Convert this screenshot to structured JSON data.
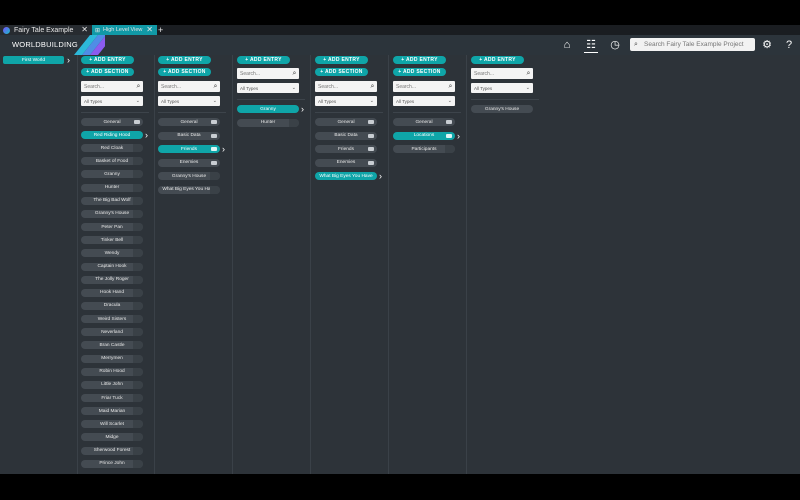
{
  "tabs": [
    {
      "label": "Fairy Tale Example",
      "close": "✕"
    },
    {
      "label": "High Level View",
      "close": "✕"
    }
  ],
  "tab_add": "+",
  "header": {
    "brand": "WORLDBUILDING",
    "search_placeholder": "Search Fairy Tale Example Project"
  },
  "col0": {
    "world": "First World"
  },
  "buttons": {
    "add_entry": "+ ADD ENTRY",
    "add_section": "+ ADD SECTION"
  },
  "search": {
    "placeholder": "Search...",
    "types": "All Types"
  },
  "col1": {
    "sections": [
      "General"
    ],
    "items": [
      "Red Riding Hood",
      "Red Cloak",
      "Basket of Food",
      "Granny",
      "Hunter",
      "The Big Bad Wolf",
      "Granny's House",
      "Peter Pan",
      "Tinker Bell",
      "Wendy",
      "Captain Hook",
      "The Jolly Roger",
      "Hook Hand",
      "Dracula",
      "Weird Sisters",
      "Neverland",
      "Bran Castle",
      "Merrymen",
      "Robin Hood",
      "Little John",
      "Friar Tuck",
      "Maid Marian",
      "Will Scarlet",
      "Midge",
      "Sherwood Forest",
      "Prince John"
    ]
  },
  "col2": {
    "items": [
      "General",
      "Basic Data",
      "Friends",
      "Enemies",
      "Granny's House",
      "What Big Eyes You Have"
    ]
  },
  "col3": {
    "items": [
      "Granny",
      "Hunter"
    ]
  },
  "col4": {
    "items": [
      "General",
      "Basic Data",
      "Friends",
      "Enemies",
      "What Big Eyes You Have"
    ]
  },
  "col5": {
    "items": [
      "General",
      "Locations",
      "Participants"
    ]
  },
  "col6": {
    "items": [
      "Granny's House"
    ]
  },
  "colors": {
    "accent": "#0fa5a8",
    "background": "#2d3339"
  }
}
